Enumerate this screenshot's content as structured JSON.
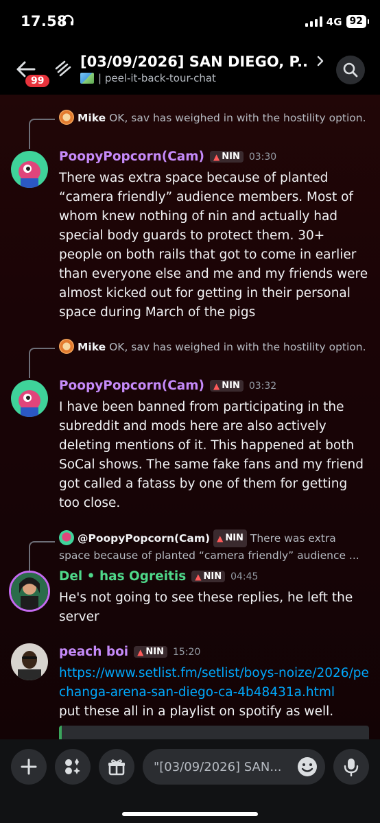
{
  "status": {
    "time": "17.58",
    "network": "4G",
    "battery": "92"
  },
  "header": {
    "back_badge": "99",
    "title": "[03/09/2026] SAN DIEGO, P...",
    "subtitle": "| peel-it-back-tour-chat"
  },
  "messages": [
    {
      "reply_author": "Mike",
      "reply_text": "OK, sav has weighed in with the hostility option.",
      "author": "PoopyPopcorn(Cam)",
      "author_color": "#c58af9",
      "tag": "NIN",
      "time": "03:30",
      "text": "There was extra space because of planted “camera friendly” audience members. Most of whom knew nothing of nin and actually had special body guards to protect them. 30+ people on both rails that got to come in earlier than everyone else and me and my friends were almost kicked out for getting in their personal space during March of the pigs"
    },
    {
      "reply_author": "Mike",
      "reply_text": "OK, sav has weighed in with the hostility option.",
      "author": "PoopyPopcorn(Cam)",
      "author_color": "#c58af9",
      "tag": "NIN",
      "time": "03:32",
      "text": "I have been banned from participating in the subreddit and mods here are also actively deleting mentions of it. This happened at both SoCal shows. The same fake fans and my friend got called a fatass by one of them for getting too close."
    },
    {
      "reply_author": "@PoopyPopcorn(Cam)",
      "reply_tag": "NIN",
      "reply_text": "There was extra space because of planted “camera friendly” audience ...",
      "author": "Del • has Ogreitis",
      "author_color": "#4fd88a",
      "tag": "NIN",
      "time": "04:45",
      "text": "He's not going to see these replies, he left the server"
    },
    {
      "author": "peach boi",
      "author_color": "#c58af9",
      "tag": "NIN",
      "time": "15:20",
      "link": "https://www.setlist.fm/setlist/boys-noize/2026/pechanga-arena-san-diego-ca-4b48431a.html",
      "text": "put these all in a playlist on spotify as well."
    }
  ],
  "composer": {
    "placeholder": "\"[03/09/2026] SAN..."
  }
}
